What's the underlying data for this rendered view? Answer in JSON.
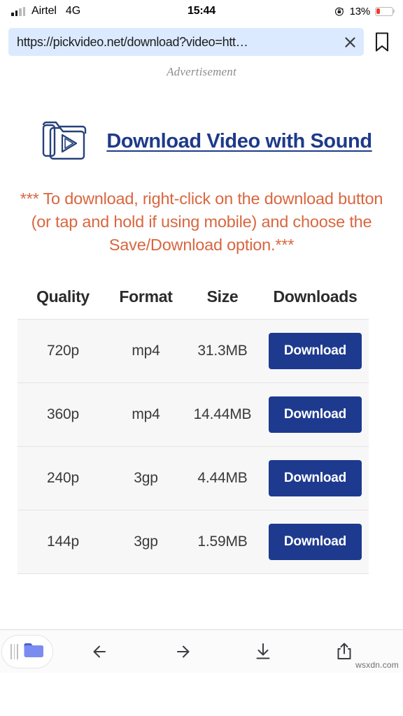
{
  "status_bar": {
    "carrier": "Airtel",
    "network": "4G",
    "time": "15:44",
    "battery_percent": "13%",
    "battery_level": 13,
    "battery_color": "#f03b30",
    "rotation_lock_icon": "rotation-lock-icon",
    "signal_icon": "signal-bars-icon"
  },
  "browser": {
    "url": "https://pickvideo.net/download?video=htt…",
    "url_placeholder": "Search or enter website name",
    "clear_icon": "close-icon",
    "bookmark_icon": "bookmark-icon"
  },
  "page": {
    "ad_label": "Advertisement",
    "brand": {
      "logo_icon": "video-folder-icon",
      "link_text": "Download Video with Sound",
      "link_color": "#1e3a8a"
    },
    "notice": "*** To download, right-click on the download button (or tap and hold if using mobile) and choose the Save/Download option.***",
    "notice_color": "#d9663f",
    "table": {
      "headers": [
        "Quality",
        "Format",
        "Size",
        "Downloads"
      ],
      "rows": [
        {
          "quality": "720p",
          "format": "mp4",
          "size": "31.3MB",
          "action": "Download"
        },
        {
          "quality": "360p",
          "format": "mp4",
          "size": "14.44MB",
          "action": "Download"
        },
        {
          "quality": "240p",
          "format": "3gp",
          "size": "4.44MB",
          "action": "Download"
        },
        {
          "quality": "144p",
          "format": "3gp",
          "size": "1.59MB",
          "action": "Download"
        }
      ],
      "button_color": "#1e3a8f"
    }
  },
  "toolbar": {
    "tabs_icon": "tabs-folder-icon",
    "back_icon": "arrow-left-icon",
    "forward_icon": "arrow-right-icon",
    "downloads_icon": "download-arrow-icon",
    "share_icon": "share-icon"
  },
  "watermark": "wsxdn.com"
}
